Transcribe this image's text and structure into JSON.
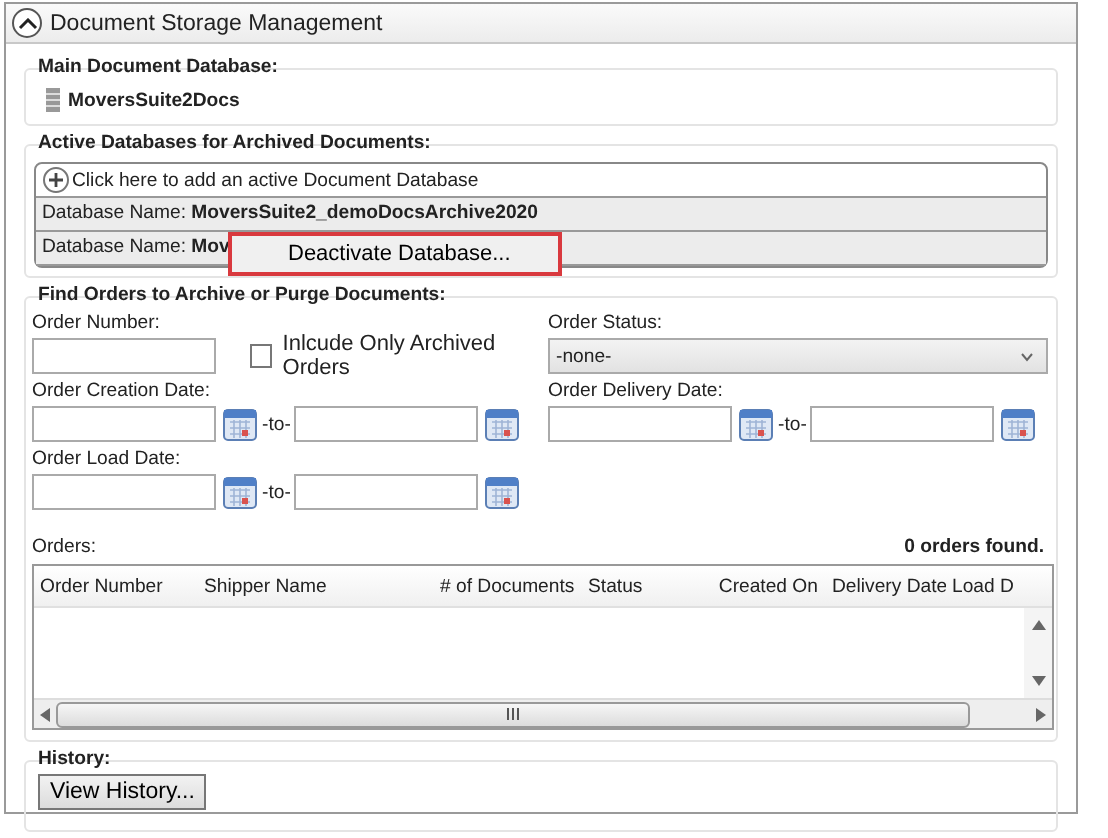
{
  "panel": {
    "title": "Document Storage Management",
    "expanded": true
  },
  "main_database": {
    "label": "Main Document Database:",
    "name": "MoversSuite2Docs"
  },
  "active_databases": {
    "label": "Active Databases for Archived Documents:",
    "add_text": "Click here to add an active Document Database",
    "rows": [
      {
        "prefix": "Database Name:",
        "name": "MoversSuite2_demoDocsArchive2020"
      },
      {
        "prefix": "Database Name:",
        "name": "Mov"
      }
    ]
  },
  "context_menu": {
    "items": [
      "Deactivate Database..."
    ]
  },
  "find_orders": {
    "label": "Find Orders to Archive or Purge Documents:",
    "order_number": {
      "label": "Order Number:"
    },
    "archived_only": {
      "label": "Inlcude Only Archived Orders",
      "checked": false
    },
    "order_status": {
      "label": "Order Status:",
      "value": "-none-"
    },
    "date_ranges": [
      {
        "label": "Order Creation Date:",
        "separator": "-to-"
      },
      {
        "label": "Order Delivery Date:",
        "separator": "-to-"
      },
      {
        "label": "Order Load Date:",
        "separator": "-to-"
      }
    ]
  },
  "orders": {
    "label": "Orders:",
    "count": "0 orders found.",
    "columns": [
      "Order Number",
      "Shipper Name",
      "# of Documents",
      "Status",
      "Created On",
      "Delivery Date",
      "Load D"
    ]
  },
  "history": {
    "label": "History:",
    "button": "View History..."
  }
}
